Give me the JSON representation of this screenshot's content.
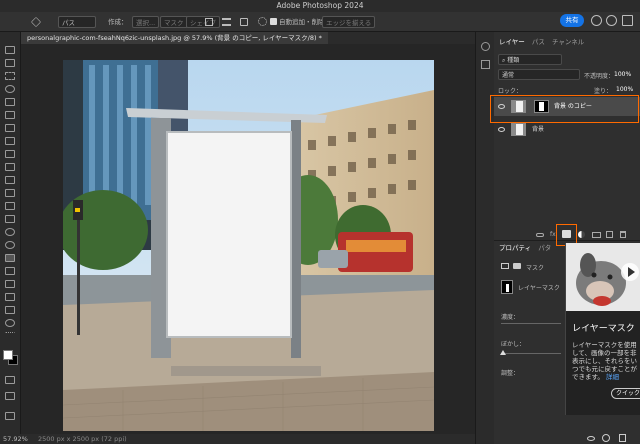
{
  "app": {
    "title": "Adobe Photoshop 2024"
  },
  "options_bar": {
    "path_mode": "パス",
    "create_label": "作成：",
    "select_btn": "選択...",
    "mask_btn": "マスク",
    "shape_btn": "シェイプ",
    "auto_add_delete": "自動追加・削除",
    "align_edges": "エッジを揃える",
    "share": "共有"
  },
  "document": {
    "tab_title": "personalgraphic-com-fseahNq6zic-unsplash.jpg @ 57.9% (背景 のコピー, レイヤーマスク/8) *",
    "zoom": "57.92%",
    "info": "2500 px x 2500 px (72 ppi)"
  },
  "layers_panel": {
    "tabs": [
      "レイヤー",
      "パス",
      "チャンネル"
    ],
    "filter_kind": "種類",
    "blend_mode": "通常",
    "opacity_label": "不透明度：",
    "opacity": "100%",
    "lock_label": "ロック：",
    "fill_label": "塗り：",
    "fill": "100%",
    "layers": [
      {
        "name": "背景 のコピー",
        "selected": true
      },
      {
        "name": "背景",
        "selected": false
      }
    ]
  },
  "properties_panel": {
    "tabs": [
      "プロパティ",
      "パタ"
    ],
    "mask_label": "マスク",
    "layer_mask_label": "レイヤーマスク",
    "density_label": "濃度：",
    "feather_label": "ぼかし：",
    "adjust_label": "調整："
  },
  "tooltip": {
    "title": "レイヤーマスク",
    "description": "レイヤーマスクを使用して、画像の一部を非表示にし、それらをいつでも元に戻すことができます。",
    "link": "詳細",
    "button": "クイック"
  }
}
